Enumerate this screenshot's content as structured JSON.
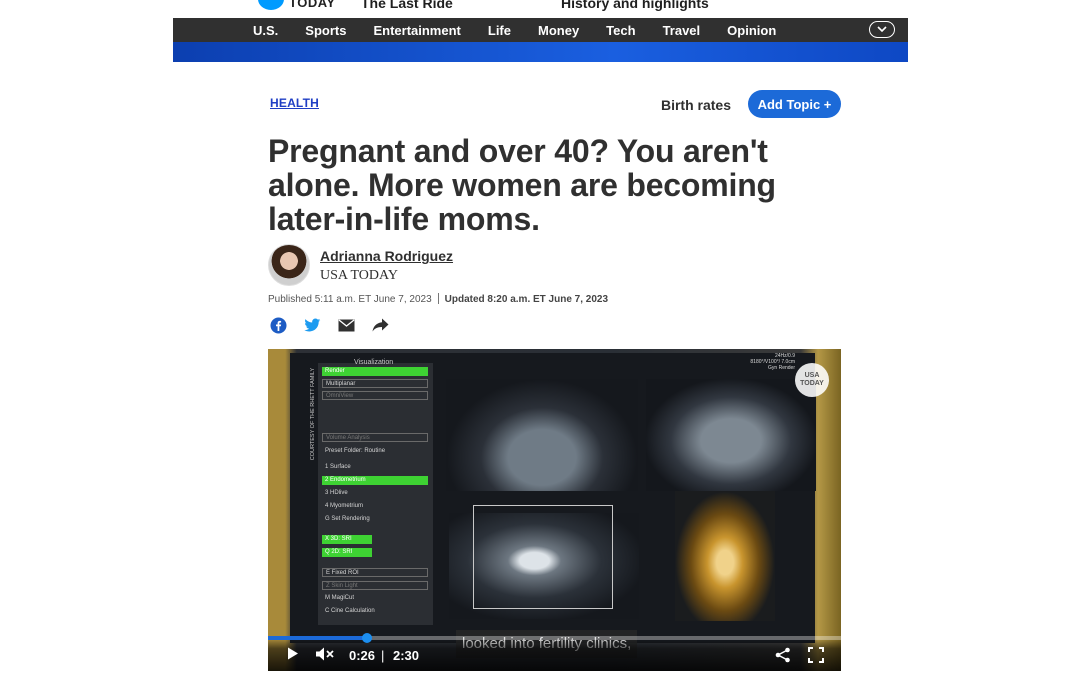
{
  "top_strip": {
    "logo_text": "TODAY",
    "promo_left": "The Last Ride",
    "promo_right": "History and highlights"
  },
  "nav": {
    "items": [
      "U.S.",
      "Sports",
      "Entertainment",
      "Life",
      "Money",
      "Tech",
      "Travel",
      "Opinion"
    ],
    "expand_icon": "chevron-down-icon"
  },
  "article": {
    "section": "HEALTH",
    "topic": "Birth rates",
    "add_topic": "Add Topic +",
    "headline": "Pregnant and over 40? You aren't alone. More women are becoming later-in-life moms.",
    "author": "Adrianna Rodriguez",
    "outlet": "USA TODAY",
    "published": "Published 5:11 a.m. ET June 7, 2023",
    "updated": "Updated 8:20 a.m. ET June 7, 2023",
    "share_icons": [
      "facebook-icon",
      "twitter-icon",
      "email-icon",
      "share-arrow-icon"
    ]
  },
  "video": {
    "panel_title": "Visualization",
    "courtesy": "COURTESY OF THE RHETT FAMILY",
    "panel_rows": [
      "Render",
      "Multiplanar",
      "OmniView",
      "Volume Analysis",
      "Preset Folder: Routine",
      "1  Surface",
      "2  Endometrium",
      "3  HDlive",
      "4  Myometrium",
      "G  Set Rendering",
      "X  3D: SRI",
      "Q  2D: SRI",
      "E  Fixed ROI",
      "Z  Skin Light",
      "M  MagiCut",
      "C  Cine Calculation"
    ],
    "scan_info": "24Hz/0.9\n8180°/V100°/ 7.0cm\nGyn Render",
    "watermark": "USA TODAY",
    "caption": "looked into fertility clinics,",
    "current_time": "0:26",
    "duration": "2:30",
    "progress": 0.173,
    "accent_color": "#1c6ad8"
  }
}
